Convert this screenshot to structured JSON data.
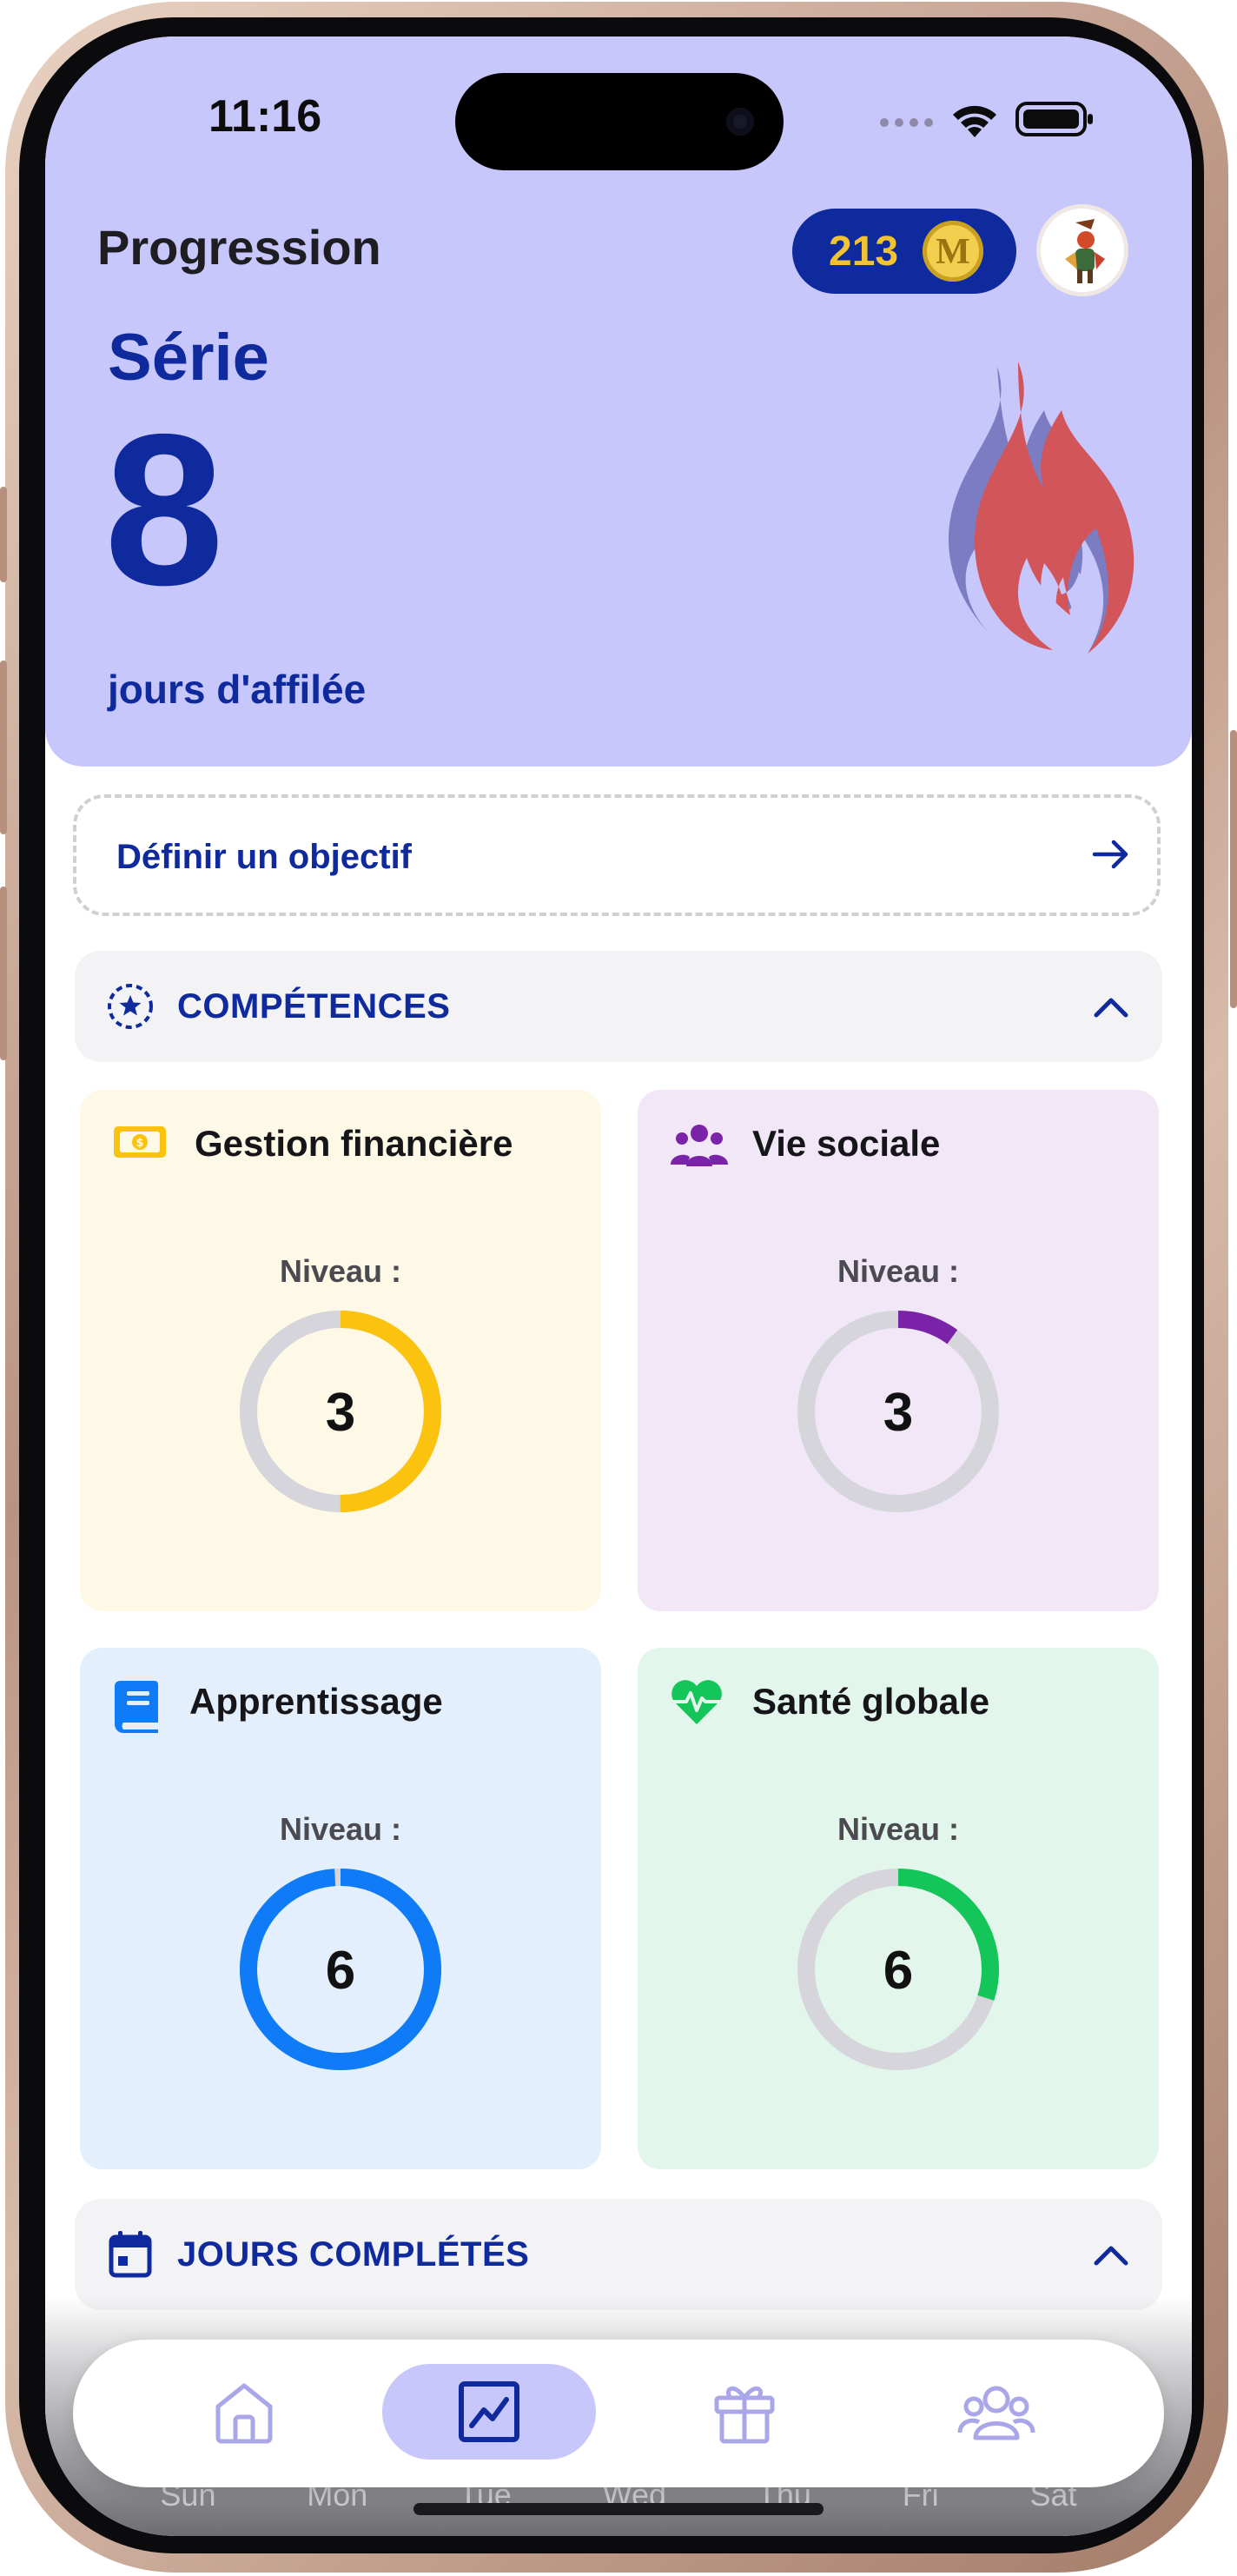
{
  "status_bar": {
    "time": "11:16"
  },
  "header": {
    "title": "Progression",
    "coins": "213",
    "coin_symbol": "M",
    "streak_label": "Série",
    "streak_value": "8",
    "streak_sub": "jours d'affilée"
  },
  "objective": {
    "label": "Définir un objectif"
  },
  "skills_section": {
    "label": "COMPÉTENCES"
  },
  "skills": [
    {
      "title": "Gestion financière",
      "level_label": "Niveau :",
      "level": "3",
      "progress": 0.5,
      "color": "#fbc30e",
      "bg": "#fef8e6",
      "icon": "money-icon"
    },
    {
      "title": "Vie sociale",
      "level_label": "Niveau :",
      "level": "3",
      "progress": 0.1,
      "color": "#7a22a8",
      "bg": "#f1e7f6",
      "icon": "people-icon"
    },
    {
      "title": "Apprentissage",
      "level_label": "Niveau :",
      "level": "6",
      "progress": 0.99,
      "color": "#0f7bf7",
      "bg": "#e3effc",
      "icon": "book-icon"
    },
    {
      "title": "Santé globale",
      "level_label": "Niveau :",
      "level": "6",
      "progress": 0.3,
      "color": "#14c55a",
      "bg": "#e2f6ec",
      "icon": "heart-pulse-icon"
    }
  ],
  "days_section": {
    "label": "JOURS COMPLÉTÉS"
  },
  "week_days": [
    "Sun",
    "Mon",
    "Tue",
    "Wed",
    "Thu",
    "Fri",
    "Sat"
  ],
  "tabs": [
    {
      "name": "home",
      "icon": "home-icon",
      "active": false
    },
    {
      "name": "progression",
      "icon": "chart-icon",
      "active": true
    },
    {
      "name": "rewards",
      "icon": "gift-icon",
      "active": false
    },
    {
      "name": "community",
      "icon": "group-icon",
      "active": false
    }
  ],
  "colors": {
    "accent": "#0f2a9c",
    "header_bg": "#c8c7fb",
    "coin": "#f1c232",
    "flame": "#d2555a"
  }
}
